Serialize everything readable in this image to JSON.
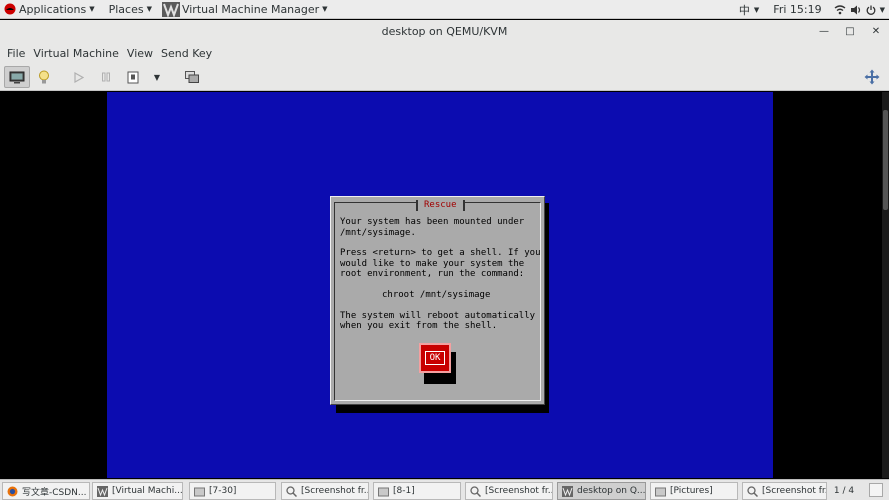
{
  "topbar": {
    "applications_label": "Applications",
    "places_label": "Places",
    "app_menu_label": "Virtual Machine Manager",
    "input_method": "中",
    "clock": "Fri 15:19"
  },
  "window": {
    "title": "desktop on QEMU/KVM"
  },
  "menu": {
    "file": "File",
    "virtual_machine": "Virtual Machine",
    "view": "View",
    "send_key": "Send Key"
  },
  "toolbar": {
    "icons": [
      "console-icon",
      "lightbulb-icon",
      "run-icon",
      "pause-icon",
      "shutdown-icon",
      "dropdown-arrow-icon",
      "snapshots-icon",
      "fullscreen-icon"
    ]
  },
  "rescue": {
    "title": "Rescue",
    "line1": "Your system has been mounted under",
    "line2": "/mnt/sysimage.",
    "line3": "Press <return> to get a shell. If you",
    "line4": "would like to make your system the",
    "line5": "root environment, run the command:",
    "command": "chroot /mnt/sysimage",
    "line6": "The system will reboot automatically",
    "line7": "when you exit from the shell.",
    "ok_label": "OK"
  },
  "colors": {
    "guest_background": "#0c0cb0",
    "dialog_background": "#aaaaaa",
    "dialog_title": "#a00000",
    "ok_button": "#c80000"
  },
  "taskbar": {
    "tasks": [
      {
        "label": "写文章-CSDN...",
        "icon": "firefox-icon",
        "active": false
      },
      {
        "label": "[Virtual Machi...",
        "icon": "vmm-icon",
        "active": false
      },
      {
        "label": "[7-30]",
        "icon": "folder-icon",
        "active": false
      },
      {
        "label": "[Screenshot fr...",
        "icon": "image-viewer-icon",
        "active": false
      },
      {
        "label": "[8-1]",
        "icon": "folder-icon",
        "active": false
      },
      {
        "label": "[Screenshot fr...",
        "icon": "image-viewer-icon",
        "active": false
      },
      {
        "label": "desktop on Q...",
        "icon": "vmm-icon",
        "active": true
      },
      {
        "label": "[Pictures]",
        "icon": "folder-icon",
        "active": false
      },
      {
        "label": "[Screenshot fr...",
        "icon": "image-viewer-icon",
        "active": false
      }
    ],
    "workspace": "1 / 4"
  }
}
